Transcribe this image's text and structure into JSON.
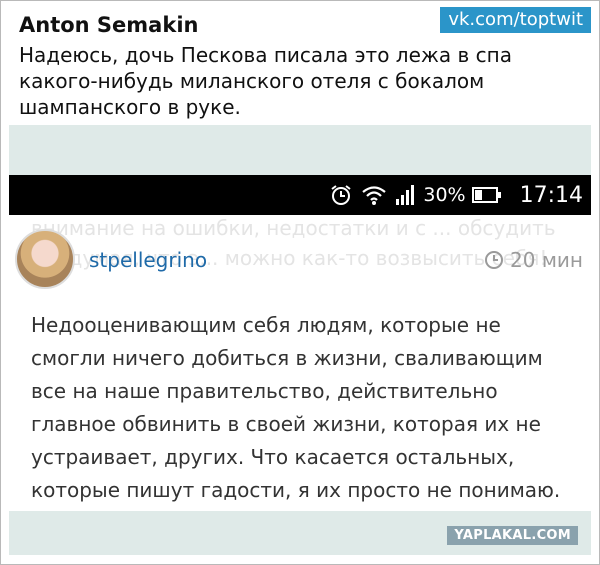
{
  "tweet": {
    "author": "Anton Semakin",
    "text": "Надеюсь, дочь Пескова писала это лежа в спа какого-нибудь миланского отеля с бокалом шампанского в руке.",
    "watermark": "vk.com/toptwit"
  },
  "status_bar": {
    "battery_percent": "30%",
    "time": "17:14",
    "icons": [
      "alarm-icon",
      "wifi-icon",
      "signal-icon",
      "battery-icon"
    ]
  },
  "comment": {
    "background_text": "внимание на ошибки, недостатки и с ... обсудить их, думая, что э... можно как-то возвысить себя!",
    "username": "stpellegrino",
    "time": "20 мин",
    "text": "Недооценивающим себя людям, которые не смогли ничего добиться в жизни, сваливающим все на наше правительство, действительно главное обвинить в своей жизни, которая их не устраивает, других. Что касается остальных, которые пишут гадости, я их просто не понимаю."
  },
  "footer_watermark": "YAPLAKAL.COM",
  "colors": {
    "band": "#dfeae8",
    "watermark_blue": "#2b95c9",
    "username_blue": "#1f6aa8",
    "yaplakal": "#8aa2ad"
  }
}
